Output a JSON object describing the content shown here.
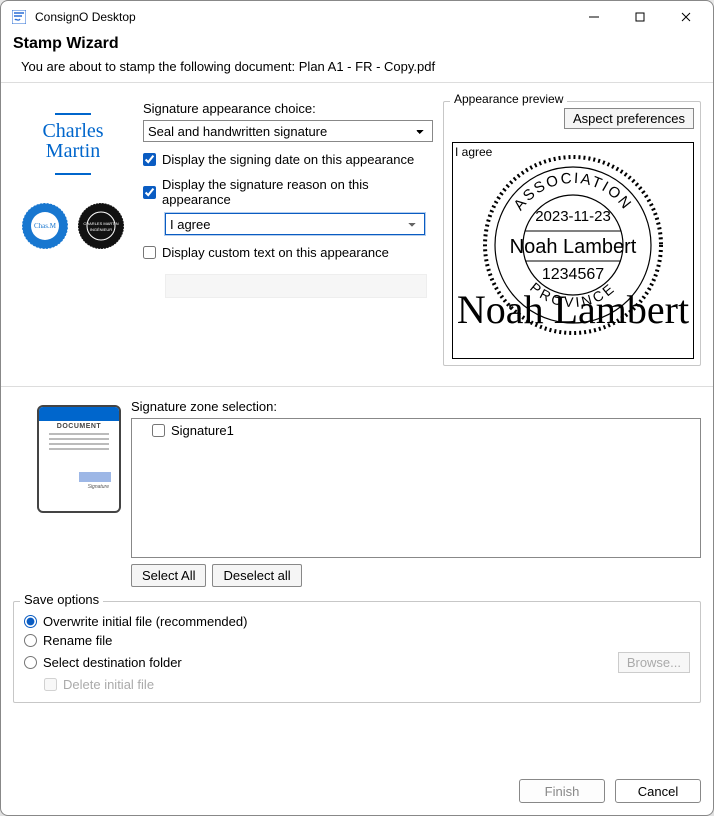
{
  "app_title": "ConsignO Desktop",
  "wizard_title": "Stamp Wizard",
  "wizard_sub": "You are about to stamp the following document: Plan A1 - FR - Copy.pdf",
  "side_cursive": "Charles Martin",
  "appearance": {
    "label": "Signature appearance choice:",
    "selected": "Seal and handwritten signature",
    "opt_date": "Display the signing date on this appearance",
    "opt_reason": "Display the signature reason on this appearance",
    "reason_value": "I agree",
    "opt_custom": "Display custom text on this appearance"
  },
  "preview": {
    "label": "Appearance preview",
    "aspect_btn": "Aspect preferences",
    "agree_text": "I agree",
    "org": "ASSOCIATION",
    "date": "2023-11-23",
    "name": "Noah Lambert",
    "id": "1234567",
    "prov": "PROVINCE",
    "sig_script": "Noah Lambert"
  },
  "sigzone": {
    "label": "Signature zone selection:",
    "items": [
      "Signature1"
    ],
    "select_all": "Select All",
    "deselect_all": "Deselect all"
  },
  "doc_thumb_title": "DOCUMENT",
  "save": {
    "label": "Save options",
    "r1": "Overwrite initial file (recommended)",
    "r2": "Rename file",
    "r3": "Select destination folder",
    "browse": "Browse...",
    "delete": "Delete initial file"
  },
  "buttons": {
    "finish": "Finish",
    "cancel": "Cancel"
  }
}
